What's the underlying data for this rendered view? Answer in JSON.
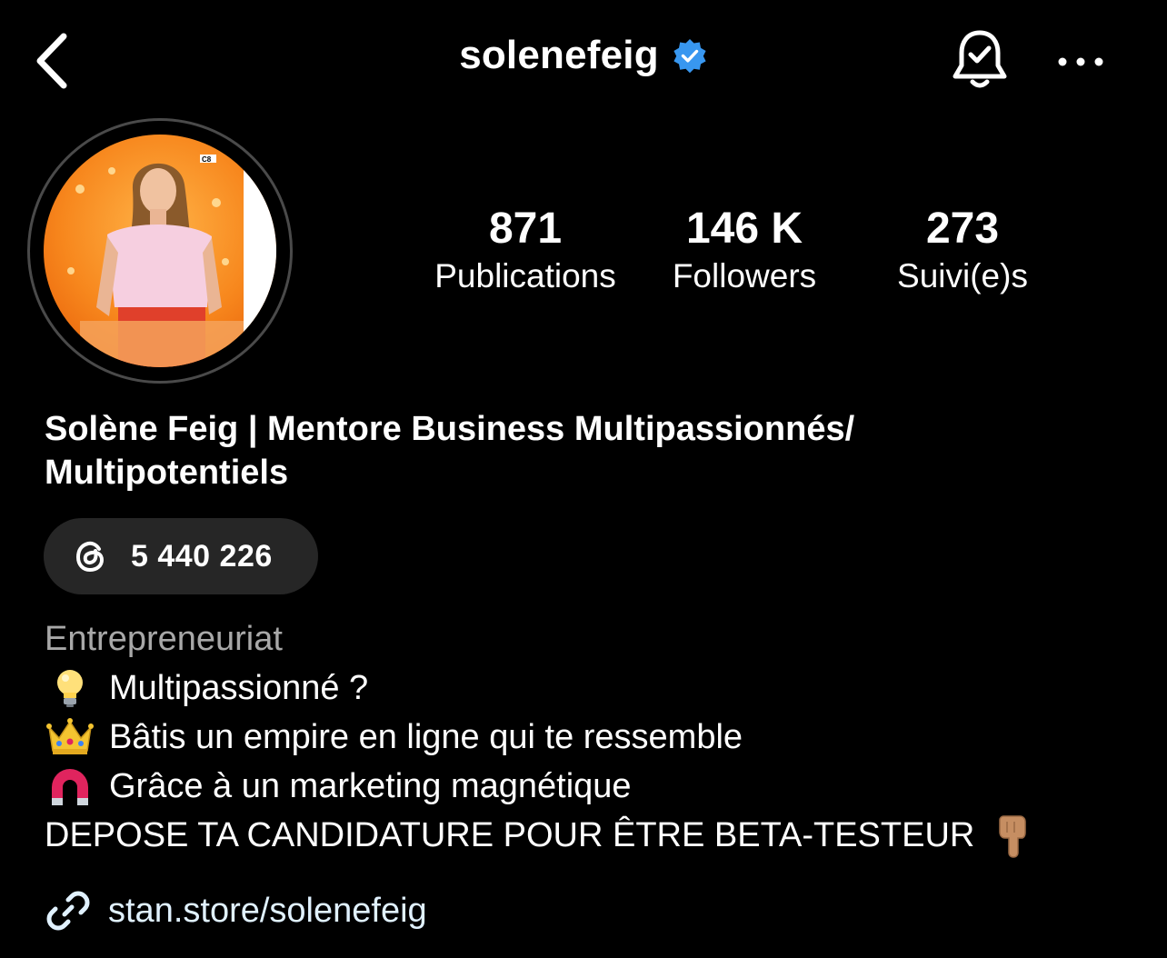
{
  "header": {
    "username": "solenefeig",
    "colors": {
      "verified": "#3897f0"
    },
    "icons": {
      "back": "chevron-left-icon",
      "verified": "verified-badge-icon",
      "bell": "bell-check-icon",
      "more": "more-horizontal-icon"
    }
  },
  "stats": [
    {
      "value": "871",
      "label": "Publications"
    },
    {
      "value": "146 K",
      "label": "Followers"
    },
    {
      "value": "273",
      "label": "Suivi(e)s"
    }
  ],
  "profile": {
    "full_name_line1": "Solène Feig | Mentore Business Multipassionnés/",
    "full_name_line2": "Multipotentiels"
  },
  "threads": {
    "icon": "threads-icon",
    "count": "5 440 226"
  },
  "bio": {
    "category": "Entrepreneuriat",
    "lines": [
      {
        "emoji": "lightbulb-emoji",
        "text": "Multipassionné ?"
      },
      {
        "emoji": "crown-emoji",
        "text": "Bâtis un empire en ligne qui te ressemble"
      },
      {
        "emoji": "magnet-emoji",
        "text": "Grâce à un marketing magnétique"
      },
      {
        "emoji": "pointing-down-emoji",
        "text": "DEPOSE TA CANDIDATURE POUR ÊTRE BETA-TESTEUR"
      }
    ]
  },
  "link": {
    "icon": "link-icon",
    "text": "stan.store/solenefeig"
  }
}
